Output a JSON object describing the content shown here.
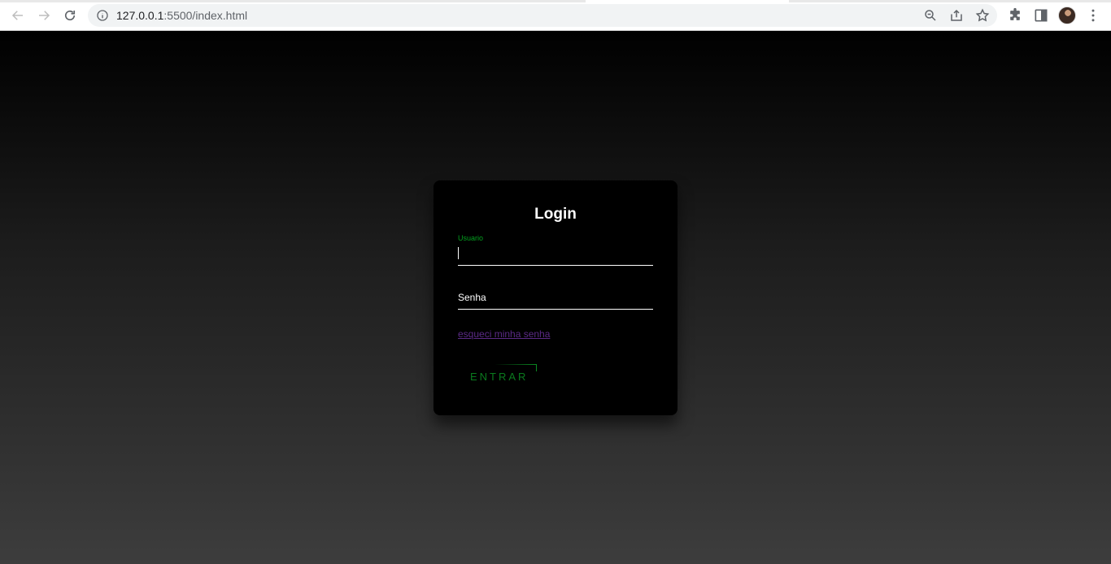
{
  "browser": {
    "url_host": "127.0.0.1",
    "url_path": ":5500/index.html"
  },
  "login": {
    "title": "Login",
    "username_label": "Usuario",
    "password_placeholder": "Senha",
    "forgot_link": "esqueci minha senha",
    "submit_label": "ENTRAR"
  },
  "colors": {
    "accent_green": "#03a01e",
    "link_purple": "#5b2a86"
  }
}
